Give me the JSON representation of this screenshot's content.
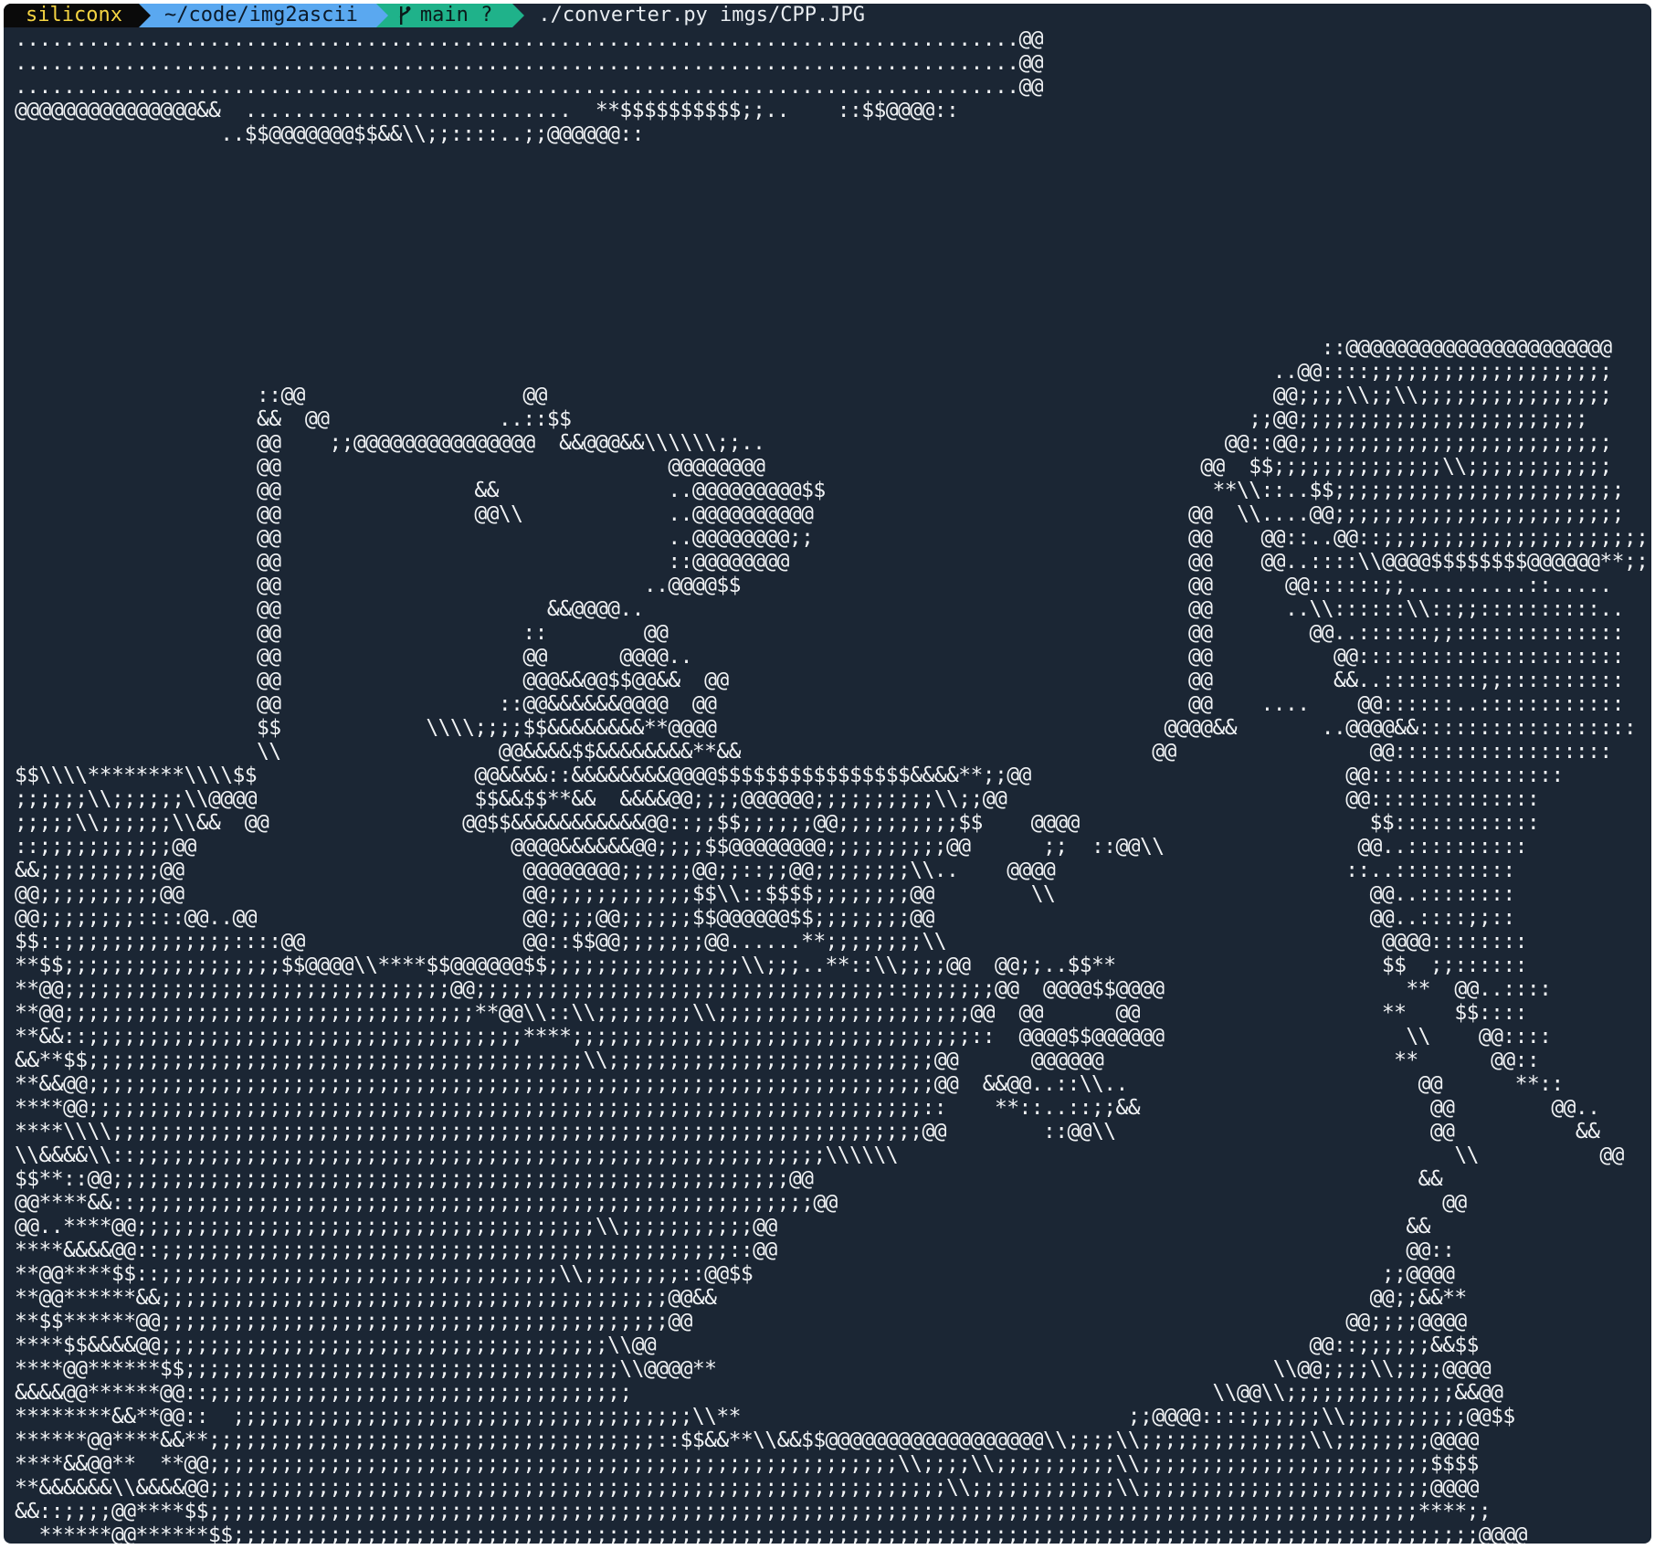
{
  "prompt": {
    "user": "siliconx",
    "path": "~/code/img2ascii",
    "branch_icon": "git-branch-icon",
    "branch": "main ?",
    "command": "./converter.py imgs/CPP.JPG"
  },
  "colors": {
    "background": "#1b2634",
    "user_segment": "#0a0a0a",
    "user_text": "#f5d442",
    "path_segment": "#5aa8f0",
    "git_segment": "#1fb28a",
    "text": "#f0f2f4"
  },
  "output_lines": [
    "...................................................................................@@",
    "...................................................................................@@",
    "...................................................................................@@",
    "@@@@@@@@@@@@@@@&&  ...........................  **$$$$$$$$$$;;..    ::$$@@@@::",
    "                 ..$$@@@@@@@$$&&\\\\;;::::..;;@@@@@@::",
    "",
    "",
    "",
    "",
    "",
    "",
    "",
    "",
    "                                                                                                            ::@@@@@@@@@@@@@@@@@@@@@@",
    "                                                                                                        ..@@::::;;;;;;;;;;;;;;;;;;;;",
    "                    ::@@                  @@                                                            @@;;;;\\\\;;\\\\;;;;;;;;;;;;;;;;",
    "                    &&  @@              ..::$$                                                        ;;@@;;;;;;;;;;;;;;;;;;;;;;;;",
    "                    @@    ;;@@@@@@@@@@@@@@@  &&@@@&&\\\\\\\\\\\\;;..                                      @@::@@;;;;;;;;;;;;;;;;;;;;;;;;;;",
    "                    @@                                @@@@@@@@                                    @@  $$;;;;;;;;;;;;;;\\\\;;;;;;;;;;;;",
    "                    @@                &&              ..@@@@@@@@@$$                                **\\\\::..$$;;;;;;;;;;;;;;;;;;;;;;;;",
    "                    @@                @@\\\\            ..@@@@@@@@@@                               @@  \\\\....@@;;;;;;;;;;;;;;;;;;;;;;;;",
    "                    @@                                ..@@@@@@@@;;                               @@    @@::..@@::;;;;;;;;;;;;;;;;;;;;;;",
    "                    @@                                ::@@@@@@@@                                 @@    @@..::::\\\\@@@@$$$$$$$$@@@@@@**;;",
    "                    @@                              ..@@@@$$                                     @@      @@::::::;;..........::.....",
    "                    @@                      &&@@@@..                                             @@      ..\\\\::::::\\\\::;;::::::::::..",
    "                    @@                    ::        @@                                           @@        @@..::::::;;::::::::::::::",
    "                    @@                    @@      @@@@..                                         @@          @@::::::::::::::::::::::",
    "                    @@                    @@@&&@@$$@@&&  @@                                      @@          &&..::::::::;;::::::::::",
    "                    @@                  ::@@&&&&&&@@@@  @@                                       @@    ....    @@::::::..::::::::::::",
    "                    $$            \\\\\\\\;;;;$$&&&&&&&&**@@@@                                     @@@@&&       ..@@@@&&::::::::::::::::::",
    "                    \\\\                  @@&&&&$$&&&&&&&&**&&                                  @@                @@::::::::::::::::::",
    "$$\\\\\\\\********\\\\\\\\$$                  @@&&&&::&&&&&&&&@@@@$$$$$$$$$$$$$$$$&&&&**;;@@                          @@::::::::::::::::",
    ";;;;;;\\\\;;;;;;\\\\@@@@                  $$&&$$**&&  &&&&@@;;;;@@@@@@;;;;;;;;;;\\\\;;@@                            @@::::::::::::::",
    ";;;;;\\\\;;;;;;\\\\&&  @@                @@$$&&&&&&&&&&&@@::;;$$;;;;;;@@;;;;;;;;;;$$    @@@@                        $$::::::::::::",
    "::;;;;;;;;;;;@@                          @@@@&&&&&&@@;;;;$$@@@@@@@@;;;;;;;;;;@@      ;;  ::@@\\\\                @@..::::::::::",
    "&&;;;;;;;;;;@@                            @@@@@@@@;;;;;;@@;;::;;@@;;;;;;;;\\\\..    @@@@                        ::..::::::::::",
    "@@;;;;;;;;;;@@                            @@;;;;;;;;;;;;$$\\\\::$$$$;;;;;;;;@@        \\\\                          @@..::::::::",
    "@@;;;;;;;;::::@@..@@                      @@;;;;@@;;;;;;$$@@@@@@$$;;;;;;;;@@                                    @@..::::;;::",
    "$$::;;;;;;;;;;;;;;::::@@                  @@::$$@@;;;;;;;@@......**;;;;;;;;\\\\                                    @@@@::::::::",
    "**$$;;;;;;;;;;;;;;;;;;$$@@@@\\\\****$$@@@@@@$$;;;;;;;;;;;;;;;;\\\\;;;..**::\\\\;;;;@@  @@;;..$$**                      $$  ;;::::::",
    "**@@;;;;;;;;;;;;;;;;;;;;;;;;;;;;;;;;@@;;;;;;;;;;;;;;;;;;;;;;;;;;;;;;;;;;::;;;;;;;@@  @@@@$$@@@@                    **  @@..::::",
    "**@@;;;;;;;;;;;;;;;;;;;;;;;;;;;;;;;;;;**@@\\\\::\\\\;;;;;;;;\\\\;;;;;;;;;;;;;;;;;;;;;@@  @@      @@                    **    $$::::",
    "**&&::;;;;;;;;;;;;;;;;;;;;;;;;;;;;;;;;;;;;****;;;;;;;;;;;;;;;;;;;;;;;;;;;;;;;;;::  @@@@$$@@@@@@                    \\\\    @@::::",
    "&&**$$;;;;;;;;;;;;;;;;;;;;;;;;;;;;;;;;;;;;;;;;;\\\\;;;;;;;;;;;;;;;;;;;;;;;;;;;@@      @@@@@@                        **      @@::",
    "**&&@@;;;;;;;;;;;;;;;;;;;;;;;;;;;;;;;;;;;;;;;;;;;;;;;;;;;;;;;;;;;;;;;;;;;;;;@@  &&@@..::\\\\..                        @@      **::",
    "****@@;;;;;;;;;;;;;;;;;;;;;;;;;;;;;;;;;;;;;;;;;;;;;;;;;;;;;;;;;;;;;;;;;;;;;::    **::..::;;&&                        @@        @@..",
    "****\\\\\\\\;;;;;;;;;;;;;;;;;;;;;;;;;;;;;;;;;;;;;;;;;;;;;;;;;;;;;;;;;;;;;;;;;;;@@        ::@@\\\\                          @@          &&",
    "\\\\&&&&\\\\::;;;;;;;;;;;;;;;;;;;;;;;;;;;;;;;;;;;;;;;;;;;;;;;;;;;;;;;;;\\\\\\\\\\\\                                              \\\\          @@",
    "$$**::@@;;;;;;;;;;;;;;;;;;;;;;;;;;;;;;;;;;;;;;;;;;;;;;;;;;;;;;;;@@                                                  &&",
    "@@****&&::;;;;;;;;;;;;;;;;;;;;;;;;;;;;;;;;;;;;;;;;;;;;;;;;;;;;;;;;@@                                                  @@",
    "@@..****@@;;;;;;;;;;;;;;;;;;;;;;;;;;;;;;;;;;;;;;\\\\;;;;;;;;;;;@@                                                    &&",
    "****&&&&@@::;;;;;;;;;;;;;;;;;;;;;;;;;;;;;;;;;;;;;;;;;;;;;;;::@@                                                    @@::",
    "**@@****$$::;;;;;;;;;;;;;;;;;;;;;;;;;;;;;;;;;\\\\;;;;;;;;::@@$$                                                    ;;@@@@",
    "**@@******&&;;;;;;;;;;;;;;;;;;;;;;;;;;;;;;;;;;;;;;;;;;@@&&                                                      @@;;&&**",
    "**$$******@@;;;;;;;;;;;;;;;;;;;;;;;;;;;;;;;;;;;;;;;;;;@@                                                      @@;;;;@@@@",
    "****$$&&&&@@;;;;;;;;;;;;;;;;;;;;;;;;;;;;;;;;;;;;;\\\\@@                                                      @@::;;;;;;&&$$",
    "****@@******$$;;;;;;;;;;;;;;;;;;;;;;;;;;;;;;;;;;;;\\\\@@@@**                                              \\\\@@;;;;\\\\;;;;@@@@",
    "&&&&@@******@@::;;;;;;;;;;;;;;;;;;;;;;;;;;;;;;;;;;;                                                \\\\@@\\\\;;;;;;;;;;;;;;&&@@",
    "********&&**@@::  ;;;;;;;;;;;;;;;;;;;;;;;;;;;;;;;;;;;;;;\\\\**                                ;;@@@@::::;;;;;;\\\\;;;;;;;;;;@@$$",
    "******@@****&&**;;;;;;;;;;;;;;;;;;;;;;;;;;;;;;;;;;;;;::$$&&**\\\\&&$$@@@@@@@@@@@@@@@@@@\\\\;;;;\\\\;;;;;;;;;;;;;;\\\\;;;;;;;;@@@@",
    "****&&@@**  **@@;;;;;;;;;;;;;;;;;;;;;;;;;;;;;;;;;;;;;;;;;;;;;;;;;;;;;;;;;\\\\;;;;\\\\;;;;;;;;;;\\\\;;;;;;;;;;;;;;;;;;;;;;;;$$$$",
    "**&&&&&&\\\\&&&&@@;;;;;;;;;;;;;;;;;;;;;;;;;;;;;;;;;;;;;;;;;;;;;;;;;;;;;;;;;;;;;\\\\;;;;;;;;;;;;\\\\;;;;;;;;;;;;;;;;;;;;;;;;@@@@",
    "&&::;;;;@@****$$;;;;;;;;;;;;;;;;;;;;;;;;;;;;;;;;;;;;;;;;;;;;;;;;;;;;;;;;;;;;;;;;;;;;;;;;;;;;;;;;;;;;;;;;;;;;;;;;;;;;****;;",
    "  ******@@******$$;;;;;;;;;;;;;;;;;;;;;;;;;;;;;;;;;;;;;;;;;;;;;;;;;;;;;;;;;;;;;;;;;;;;;;;;;;;;;;;;;;;;;;;;;;;;;;;;;;;;;;;@@@@",
    "******&&$$****&&@@;;;;;;;;;;;;;;;;;;;;;;;;;;;;;;;;;;;;;;;;;;;;;;;;;;;;;;;;;;;;;;;;;;;;;;;;;;;;;;;;;;;;;;;;;;;;;;;;;;;;;;;;;;&&**@@"
  ]
}
